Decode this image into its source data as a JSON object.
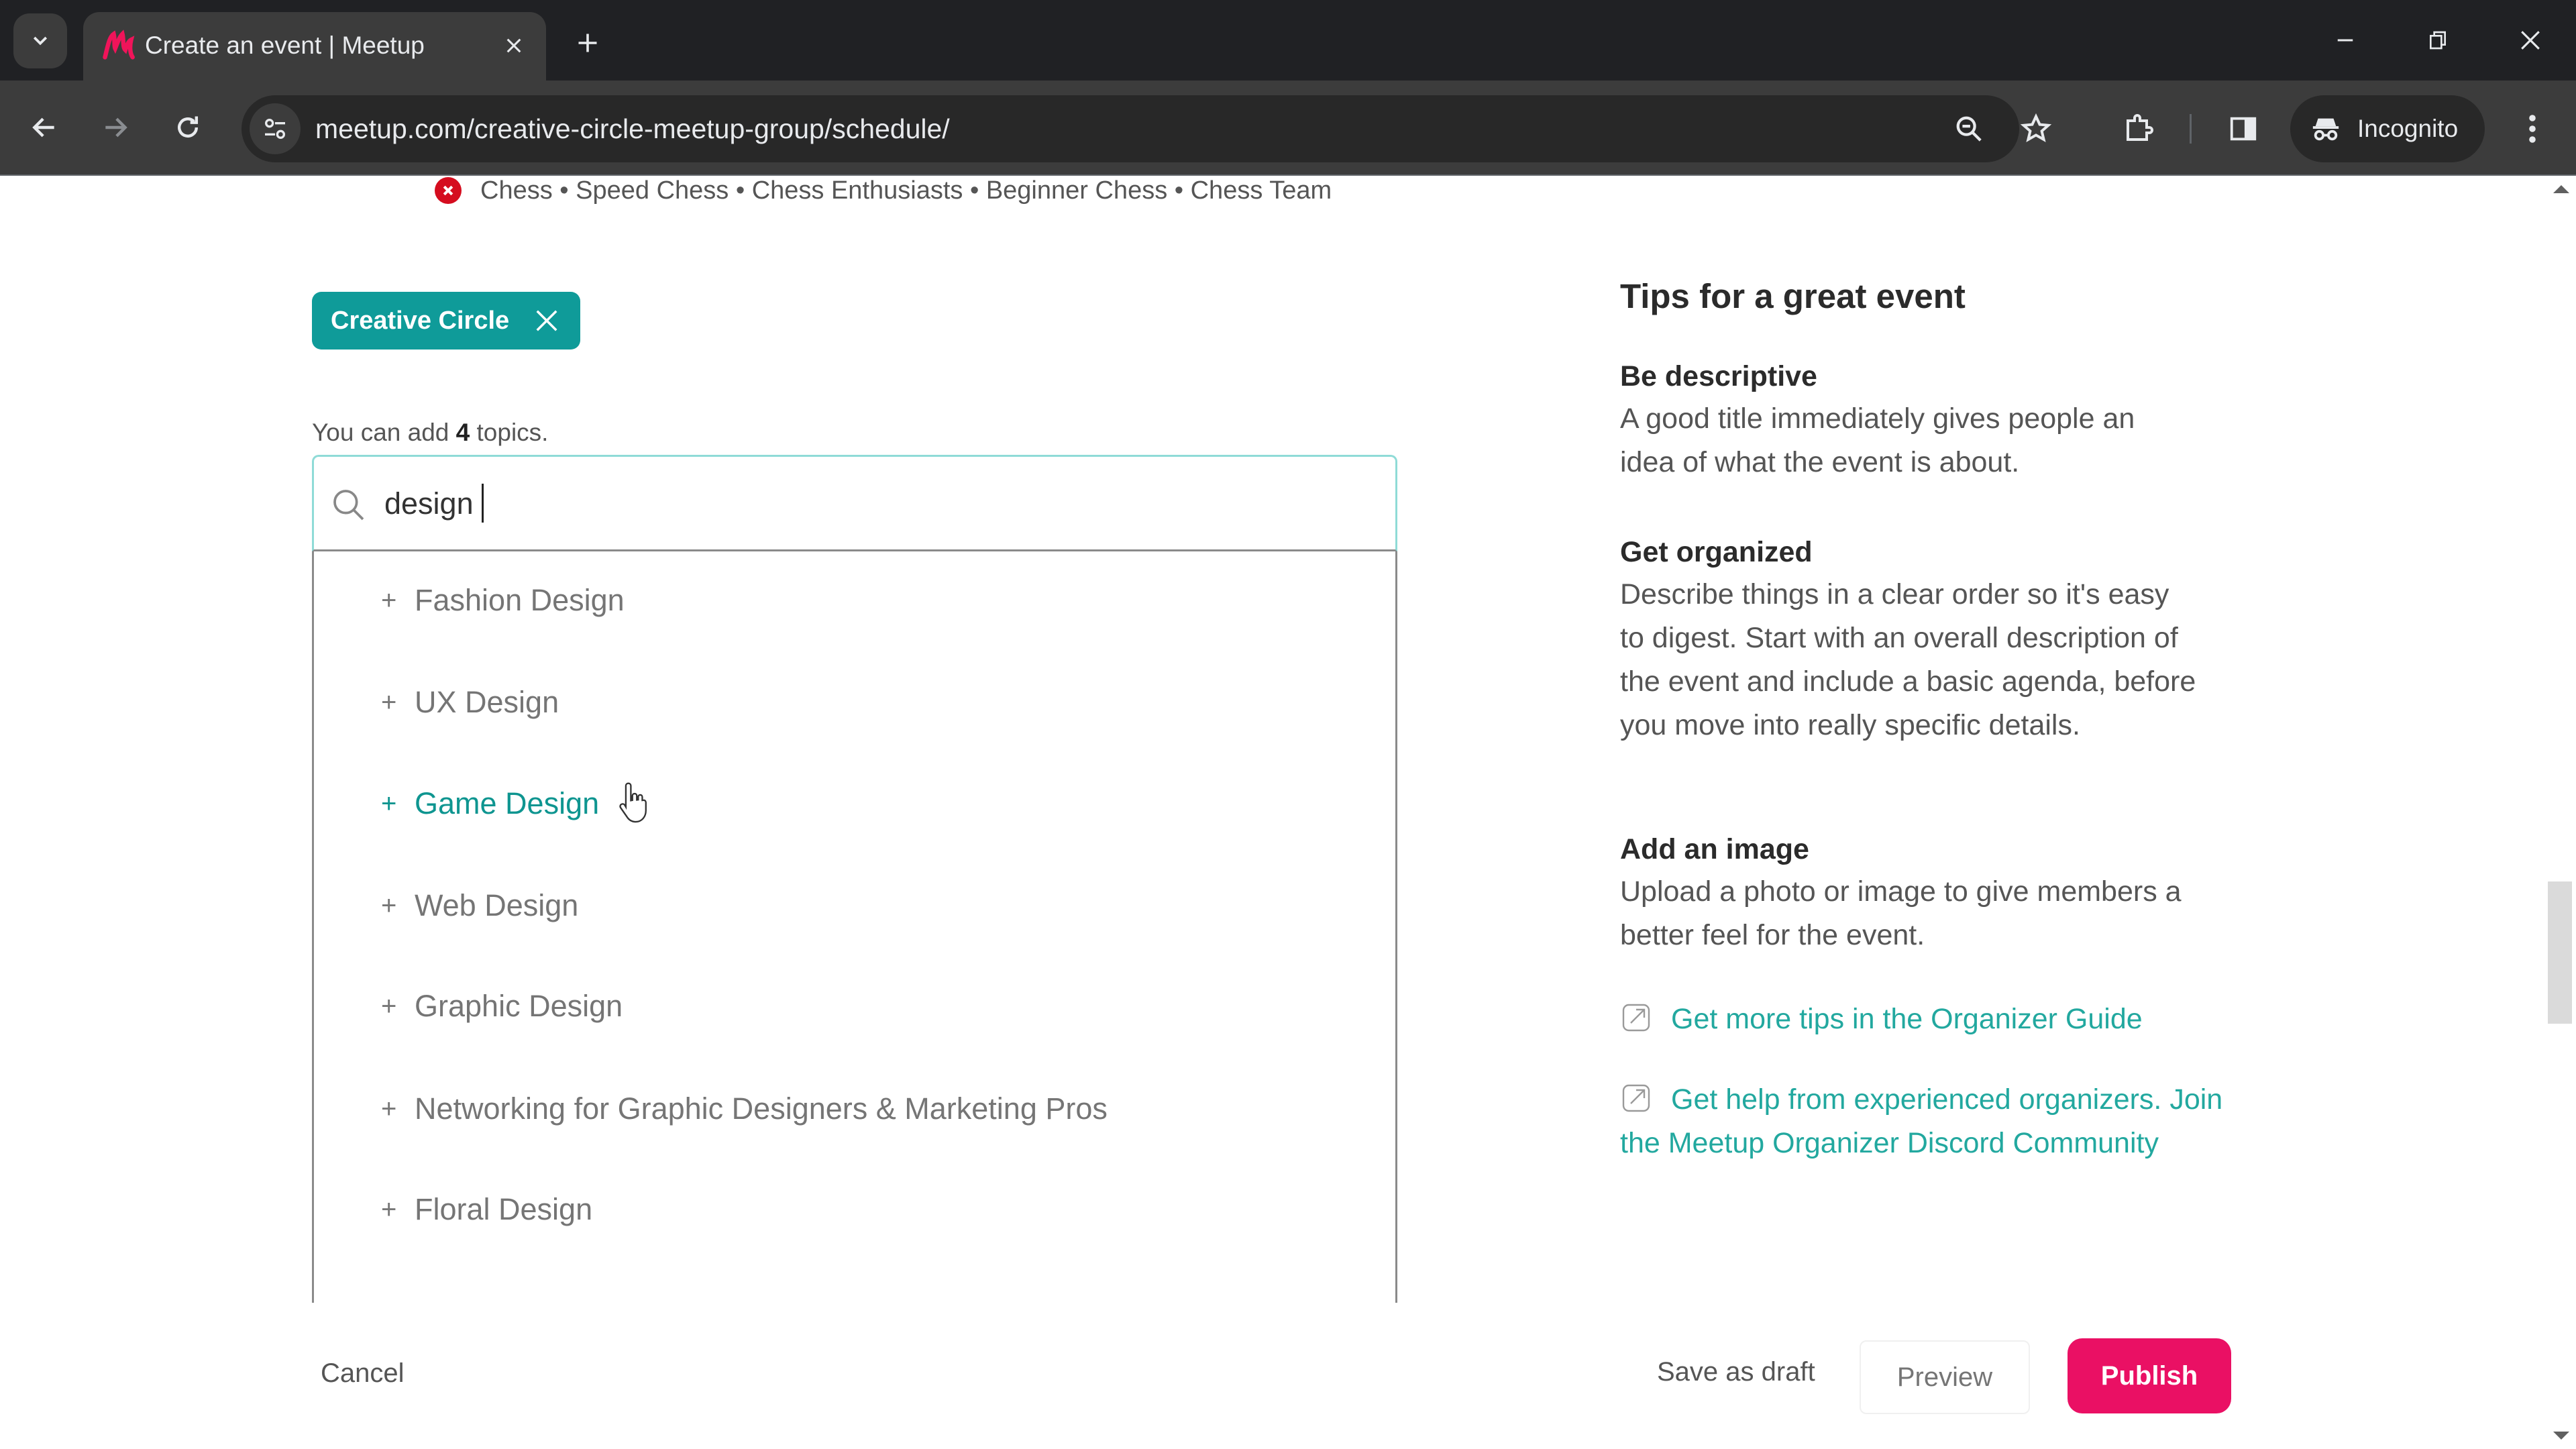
{
  "browser": {
    "tab_title": "Create an event | Meetup",
    "url": "meetup.com/creative-circle-meetup-group/schedule/",
    "profile_label": "Incognito",
    "favicon_color": "#f0145a",
    "icons": {
      "tab_search": "chevron-down-icon",
      "tab_close": "close-icon",
      "new_tab": "plus-icon",
      "minimize": "minimize-icon",
      "restore": "restore-icon",
      "close_window": "close-icon",
      "back": "arrow-left-icon",
      "forward": "arrow-right-icon",
      "reload": "reload-icon",
      "site_info": "tune-icon",
      "zoom": "zoom-out-icon",
      "bookmark": "star-icon",
      "extensions": "puzzle-icon",
      "side_panel": "side-panel-icon",
      "incognito": "incognito-icon",
      "menu": "kebab-menu-icon"
    }
  },
  "page": {
    "suggested_topics_line": "Chess • Speed Chess • Chess Enthusiasts • Beginner Chess • Chess Team",
    "selected_group_chip": "Creative Circle",
    "topics_hint": {
      "prefix": "You can add ",
      "count": "4",
      "suffix": " topics."
    },
    "search": {
      "value": "design",
      "placeholder": ""
    },
    "results": [
      {
        "label": "Fashion Design",
        "hovered": false
      },
      {
        "label": "UX Design",
        "hovered": false
      },
      {
        "label": "Game Design",
        "hovered": true
      },
      {
        "label": "Web Design",
        "hovered": false
      },
      {
        "label": "Graphic Design",
        "hovered": false
      },
      {
        "label": "Networking for Graphic Designers & Marketing Pros",
        "hovered": false
      },
      {
        "label": "Floral Design",
        "hovered": false
      }
    ],
    "result_add_symbol": "+",
    "tips": {
      "title": "Tips for a great event",
      "sections": [
        {
          "heading": "Be descriptive",
          "body": "A good title immediately gives people an idea of what the event is about."
        },
        {
          "heading": "Get organized",
          "body": "Describe things in a clear order so it's easy to digest. Start with an overall description of the event and include a basic agenda, before you move into really specific details."
        },
        {
          "heading": "Add an image",
          "body": "Upload a photo or image to give members a better feel for the event."
        }
      ],
      "links": [
        {
          "label": "Get more tips in the Organizer Guide"
        },
        {
          "label": "Get help from experienced organizers. Join the Meetup Organizer Discord Community"
        }
      ]
    },
    "footer": {
      "cancel": "Cancel",
      "save_draft": "Save as draft",
      "preview": "Preview",
      "publish": "Publish"
    },
    "colors": {
      "accent_teal": "#0f9b99",
      "link_teal": "#22a89f",
      "publish_pink": "#ea1064",
      "error_red": "#d50d1f"
    }
  }
}
